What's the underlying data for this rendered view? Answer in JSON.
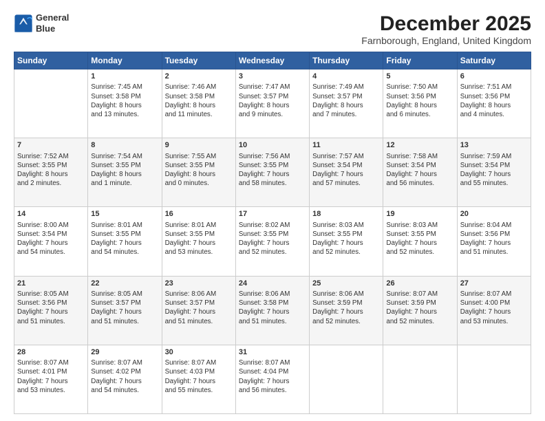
{
  "logo": {
    "line1": "General",
    "line2": "Blue"
  },
  "title": "December 2025",
  "location": "Farnborough, England, United Kingdom",
  "days_of_week": [
    "Sunday",
    "Monday",
    "Tuesday",
    "Wednesday",
    "Thursday",
    "Friday",
    "Saturday"
  ],
  "weeks": [
    [
      {
        "day": "",
        "info": ""
      },
      {
        "day": "1",
        "info": "Sunrise: 7:45 AM\nSunset: 3:58 PM\nDaylight: 8 hours\nand 13 minutes."
      },
      {
        "day": "2",
        "info": "Sunrise: 7:46 AM\nSunset: 3:58 PM\nDaylight: 8 hours\nand 11 minutes."
      },
      {
        "day": "3",
        "info": "Sunrise: 7:47 AM\nSunset: 3:57 PM\nDaylight: 8 hours\nand 9 minutes."
      },
      {
        "day": "4",
        "info": "Sunrise: 7:49 AM\nSunset: 3:57 PM\nDaylight: 8 hours\nand 7 minutes."
      },
      {
        "day": "5",
        "info": "Sunrise: 7:50 AM\nSunset: 3:56 PM\nDaylight: 8 hours\nand 6 minutes."
      },
      {
        "day": "6",
        "info": "Sunrise: 7:51 AM\nSunset: 3:56 PM\nDaylight: 8 hours\nand 4 minutes."
      }
    ],
    [
      {
        "day": "7",
        "info": "Sunrise: 7:52 AM\nSunset: 3:55 PM\nDaylight: 8 hours\nand 2 minutes."
      },
      {
        "day": "8",
        "info": "Sunrise: 7:54 AM\nSunset: 3:55 PM\nDaylight: 8 hours\nand 1 minute."
      },
      {
        "day": "9",
        "info": "Sunrise: 7:55 AM\nSunset: 3:55 PM\nDaylight: 8 hours\nand 0 minutes."
      },
      {
        "day": "10",
        "info": "Sunrise: 7:56 AM\nSunset: 3:55 PM\nDaylight: 7 hours\nand 58 minutes."
      },
      {
        "day": "11",
        "info": "Sunrise: 7:57 AM\nSunset: 3:54 PM\nDaylight: 7 hours\nand 57 minutes."
      },
      {
        "day": "12",
        "info": "Sunrise: 7:58 AM\nSunset: 3:54 PM\nDaylight: 7 hours\nand 56 minutes."
      },
      {
        "day": "13",
        "info": "Sunrise: 7:59 AM\nSunset: 3:54 PM\nDaylight: 7 hours\nand 55 minutes."
      }
    ],
    [
      {
        "day": "14",
        "info": "Sunrise: 8:00 AM\nSunset: 3:54 PM\nDaylight: 7 hours\nand 54 minutes."
      },
      {
        "day": "15",
        "info": "Sunrise: 8:01 AM\nSunset: 3:55 PM\nDaylight: 7 hours\nand 54 minutes."
      },
      {
        "day": "16",
        "info": "Sunrise: 8:01 AM\nSunset: 3:55 PM\nDaylight: 7 hours\nand 53 minutes."
      },
      {
        "day": "17",
        "info": "Sunrise: 8:02 AM\nSunset: 3:55 PM\nDaylight: 7 hours\nand 52 minutes."
      },
      {
        "day": "18",
        "info": "Sunrise: 8:03 AM\nSunset: 3:55 PM\nDaylight: 7 hours\nand 52 minutes."
      },
      {
        "day": "19",
        "info": "Sunrise: 8:03 AM\nSunset: 3:55 PM\nDaylight: 7 hours\nand 52 minutes."
      },
      {
        "day": "20",
        "info": "Sunrise: 8:04 AM\nSunset: 3:56 PM\nDaylight: 7 hours\nand 51 minutes."
      }
    ],
    [
      {
        "day": "21",
        "info": "Sunrise: 8:05 AM\nSunset: 3:56 PM\nDaylight: 7 hours\nand 51 minutes."
      },
      {
        "day": "22",
        "info": "Sunrise: 8:05 AM\nSunset: 3:57 PM\nDaylight: 7 hours\nand 51 minutes."
      },
      {
        "day": "23",
        "info": "Sunrise: 8:06 AM\nSunset: 3:57 PM\nDaylight: 7 hours\nand 51 minutes."
      },
      {
        "day": "24",
        "info": "Sunrise: 8:06 AM\nSunset: 3:58 PM\nDaylight: 7 hours\nand 51 minutes."
      },
      {
        "day": "25",
        "info": "Sunrise: 8:06 AM\nSunset: 3:59 PM\nDaylight: 7 hours\nand 52 minutes."
      },
      {
        "day": "26",
        "info": "Sunrise: 8:07 AM\nSunset: 3:59 PM\nDaylight: 7 hours\nand 52 minutes."
      },
      {
        "day": "27",
        "info": "Sunrise: 8:07 AM\nSunset: 4:00 PM\nDaylight: 7 hours\nand 53 minutes."
      }
    ],
    [
      {
        "day": "28",
        "info": "Sunrise: 8:07 AM\nSunset: 4:01 PM\nDaylight: 7 hours\nand 53 minutes."
      },
      {
        "day": "29",
        "info": "Sunrise: 8:07 AM\nSunset: 4:02 PM\nDaylight: 7 hours\nand 54 minutes."
      },
      {
        "day": "30",
        "info": "Sunrise: 8:07 AM\nSunset: 4:03 PM\nDaylight: 7 hours\nand 55 minutes."
      },
      {
        "day": "31",
        "info": "Sunrise: 8:07 AM\nSunset: 4:04 PM\nDaylight: 7 hours\nand 56 minutes."
      },
      {
        "day": "",
        "info": ""
      },
      {
        "day": "",
        "info": ""
      },
      {
        "day": "",
        "info": ""
      }
    ]
  ]
}
